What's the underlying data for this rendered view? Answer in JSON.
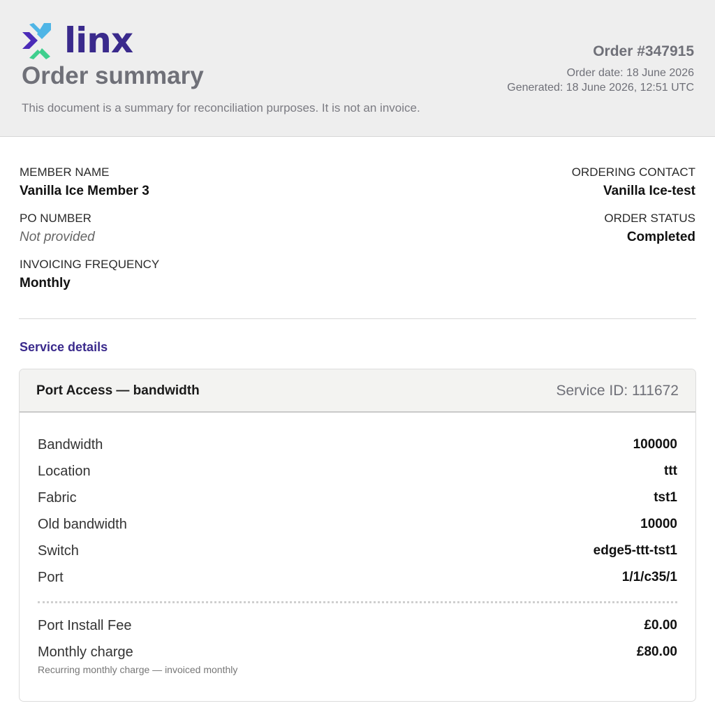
{
  "header": {
    "brand": "linx",
    "title": "Order summary",
    "note": "This document is a summary for reconciliation purposes. It is not an invoice.",
    "order_number": "Order #347915",
    "order_date": "Order date: 18 June 2026",
    "generated": "Generated: 18 June 2026, 12:51 UTC",
    "colors": {
      "brand": "#3a2a8c",
      "logo_purple": "#4b2bb8",
      "logo_blue": "#4fb5e6",
      "logo_green": "#3fcf8e"
    }
  },
  "meta": {
    "left": [
      {
        "label": "MEMBER NAME",
        "value": "Vanilla Ice Member 3",
        "muted": false
      },
      {
        "label": "PO NUMBER",
        "value": "Not provided",
        "muted": true
      },
      {
        "label": "INVOICING FREQUENCY",
        "value": "Monthly",
        "muted": false
      }
    ],
    "right": [
      {
        "label": "ORDERING CONTACT",
        "value": "Vanilla Ice-test"
      },
      {
        "label": "ORDER STATUS",
        "value": "Completed"
      }
    ]
  },
  "section": {
    "title": "Service details"
  },
  "service": {
    "title": "Port Access — bandwidth",
    "service_id": "Service ID: 111672",
    "details": [
      {
        "key": "Bandwidth",
        "value": "100000"
      },
      {
        "key": "Location",
        "value": "ttt"
      },
      {
        "key": "Fabric",
        "value": "tst1"
      },
      {
        "key": "Old bandwidth",
        "value": "10000"
      },
      {
        "key": "Switch",
        "value": "edge5-ttt-tst1"
      },
      {
        "key": "Port",
        "value": "1/1/c35/1"
      }
    ],
    "fees": [
      {
        "key": "Port Install Fee",
        "value": "£0.00"
      },
      {
        "key": "Monthly charge",
        "value": "£80.00"
      }
    ],
    "monthly_note": "Recurring monthly charge — invoiced monthly"
  }
}
